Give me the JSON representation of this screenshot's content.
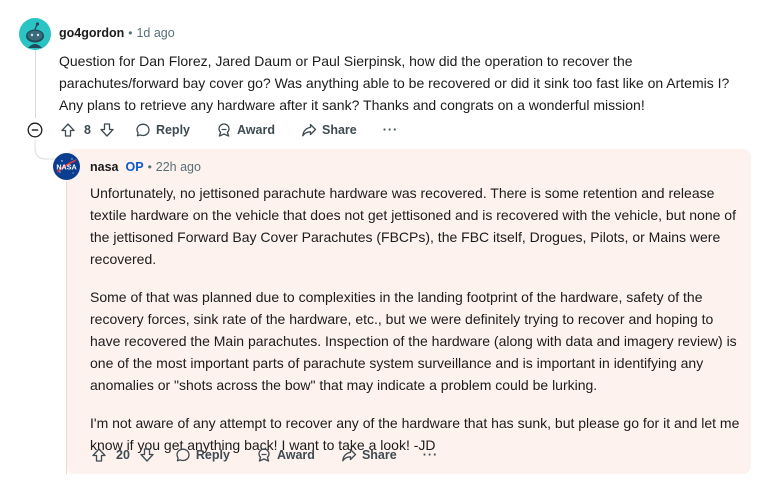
{
  "top_comment": {
    "username": "go4gordon",
    "separator": "•",
    "timestamp": "1d ago",
    "body": "Question for Dan Florez, Jared Daum or Paul Sierpinsk, how did the operation to recover the parachutes/forward bay cover go? Was anything able to be recovered or did it sink too fast like on Artemis I? Any plans to retrieve any hardware after it sank? Thanks and congrats on a wonderful mission!",
    "score": "8",
    "reply_label": "Reply",
    "award_label": "Award",
    "share_label": "Share",
    "more_label": "···"
  },
  "reply": {
    "username": "nasa",
    "op_badge": "OP",
    "separator": "•",
    "timestamp": "22h ago",
    "avatar_text": "NASA",
    "paragraphs": [
      "Unfortunately, no jettisoned parachute hardware was recovered. There is some retention and release textile hardware on the vehicle that does not get jettisoned and is recovered with the vehicle, but none of the jettisoned Forward Bay Cover Parachutes (FBCPs), the FBC itself, Drogues, Pilots, or Mains were recovered.",
      "Some of that was planned due to complexities in the landing footprint of the hardware, safety of the recovery forces, sink rate of the hardware, etc., but we were definitely trying to recover and hoping to have recovered the Main parachutes. Inspection of the hardware (along with data and imagery review) is one of the most important parts of parachute system surveillance and is important in identifying any anomalies or \"shots across the bow\" that may indicate a problem could be lurking.",
      "I'm not aware of any attempt to recover any of the hardware that has sunk, but please go for it and let me know if you get anything back! I want to take a look! -JD"
    ],
    "score": "20",
    "reply_label": "Reply",
    "award_label": "Award",
    "share_label": "Share",
    "more_label": "···"
  },
  "colors": {
    "op_badge": "#0a58ca",
    "reply_background": "#fdf2ee",
    "meta_text": "#576f76",
    "action_text": "#3e4b51"
  },
  "icons": {
    "upvote": "upvote-icon",
    "downvote": "downvote-icon",
    "reply": "comment-bubble-icon",
    "award": "award-icon",
    "share": "share-icon",
    "more": "more-icon",
    "collapse": "collapse-icon"
  }
}
